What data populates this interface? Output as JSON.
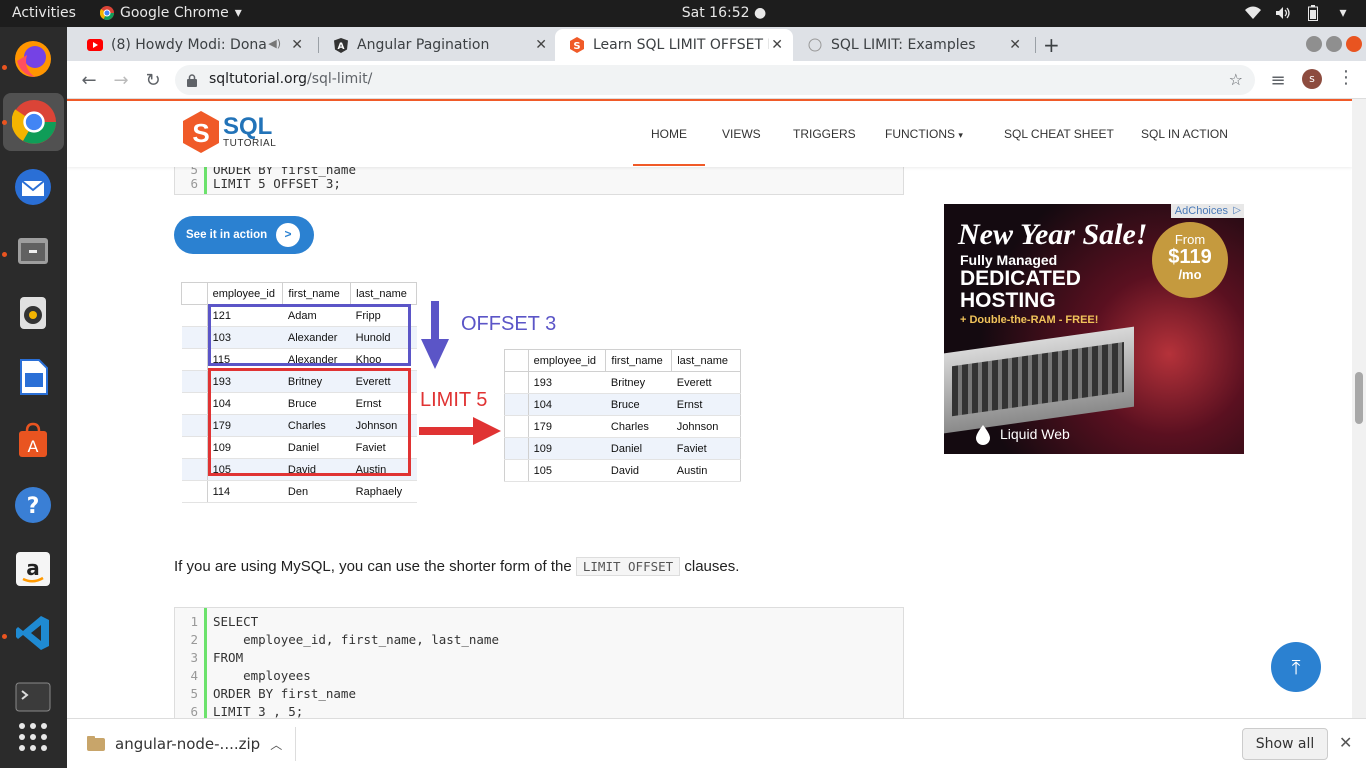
{
  "topbar": {
    "activities": "Activities",
    "app_menu": "Google Chrome",
    "clock": "Sat 16:52"
  },
  "tabs": [
    {
      "title": "(8) Howdy Modi: Dona",
      "icon": "youtube-icon"
    },
    {
      "title": "Angular Pagination",
      "icon": "angular-icon"
    },
    {
      "title": "Learn SQL LIMIT OFFSET E",
      "icon": "sqltutorial-icon"
    },
    {
      "title": "SQL LIMIT: Examples",
      "icon": "globe-icon"
    }
  ],
  "url": {
    "host": "sqltutorial.org",
    "path": "/sql-limit/"
  },
  "profile_initial": "s",
  "site": {
    "logo_main": "SQL",
    "logo_sub": "TUTORIAL",
    "nav": [
      "HOME",
      "VIEWS",
      "TRIGGERS",
      "FUNCTIONS",
      "SQL CHEAT SHEET",
      "SQL IN ACTION"
    ]
  },
  "code_top": {
    "lines": [
      {
        "n": "5",
        "text": "ORDER BY first_name"
      },
      {
        "n": "6",
        "text": "LIMIT 5 OFFSET 3;"
      }
    ]
  },
  "action_button": {
    "label": "See it in action",
    "arrow": ">"
  },
  "illustration": {
    "headers": [
      "employee_id",
      "first_name",
      "last_name"
    ],
    "left_rows": [
      [
        "121",
        "Adam",
        "Fripp"
      ],
      [
        "103",
        "Alexander",
        "Hunold"
      ],
      [
        "115",
        "Alexander",
        "Khoo"
      ],
      [
        "193",
        "Britney",
        "Everett"
      ],
      [
        "104",
        "Bruce",
        "Ernst"
      ],
      [
        "179",
        "Charles",
        "Johnson"
      ],
      [
        "109",
        "Daniel",
        "Faviet"
      ],
      [
        "105",
        "David",
        "Austin"
      ],
      [
        "114",
        "Den",
        "Raphaely"
      ]
    ],
    "right_rows": [
      [
        "193",
        "Britney",
        "Everett"
      ],
      [
        "104",
        "Bruce",
        "Ernst"
      ],
      [
        "179",
        "Charles",
        "Johnson"
      ],
      [
        "109",
        "Daniel",
        "Faviet"
      ],
      [
        "105",
        "David",
        "Austin"
      ]
    ],
    "offset_label": "OFFSET 3",
    "limit_label": "LIMIT 5",
    "offset_color": "#5b55c7",
    "limit_color": "#e03333"
  },
  "paragraph": {
    "before": "If you are using MySQL, you can use the shorter form of the ",
    "code": "LIMIT OFFSET",
    "after": " clauses."
  },
  "code_bottom": {
    "lines": [
      {
        "n": "1",
        "text": "SELECT"
      },
      {
        "n": "2",
        "text": "    employee_id, first_name, last_name"
      },
      {
        "n": "3",
        "text": "FROM"
      },
      {
        "n": "4",
        "text": "    employees"
      },
      {
        "n": "5",
        "text": "ORDER BY first_name"
      },
      {
        "n": "6",
        "text": "LIMIT 3 , 5;"
      }
    ]
  },
  "ad": {
    "choices": "AdChoices",
    "headline": "New Year Sale!",
    "line1": "Fully Managed",
    "line2": "DEDICATED",
    "line3": "HOSTING",
    "line4": "+ Double-the-RAM - FREE!",
    "badge_from": "From",
    "badge_price": "$119",
    "badge_unit": "/mo",
    "brand": "Liquid Web"
  },
  "downloads": {
    "file": "angular-node-....zip",
    "show_all": "Show all"
  },
  "colors": {
    "accent": "#f05a28",
    "brand_blue": "#2b81d1",
    "gutter_green": "#6ce26c"
  }
}
